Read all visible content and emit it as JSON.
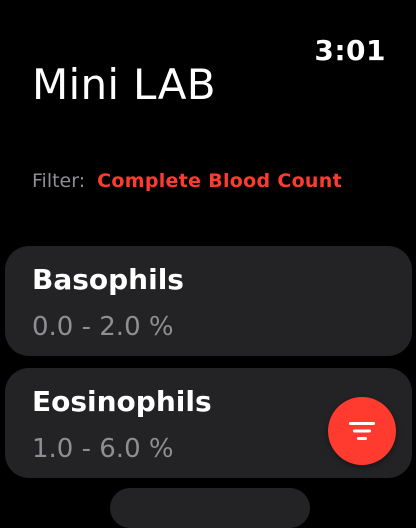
{
  "status_bar": {
    "time": "3:01"
  },
  "header": {
    "title": "Mini LAB"
  },
  "filter": {
    "label": "Filter:",
    "value": "Complete Blood Count"
  },
  "tests": [
    {
      "name": "Basophils",
      "range": "0.0 - 2.0 %"
    },
    {
      "name": "Eosinophils",
      "range": "1.0 - 6.0 %"
    }
  ],
  "fab": {
    "icon": "filter-icon"
  },
  "colors": {
    "accent": "#ff3b30",
    "card_background": "#232325",
    "secondary_text": "#8e8e93",
    "background": "#000000"
  }
}
